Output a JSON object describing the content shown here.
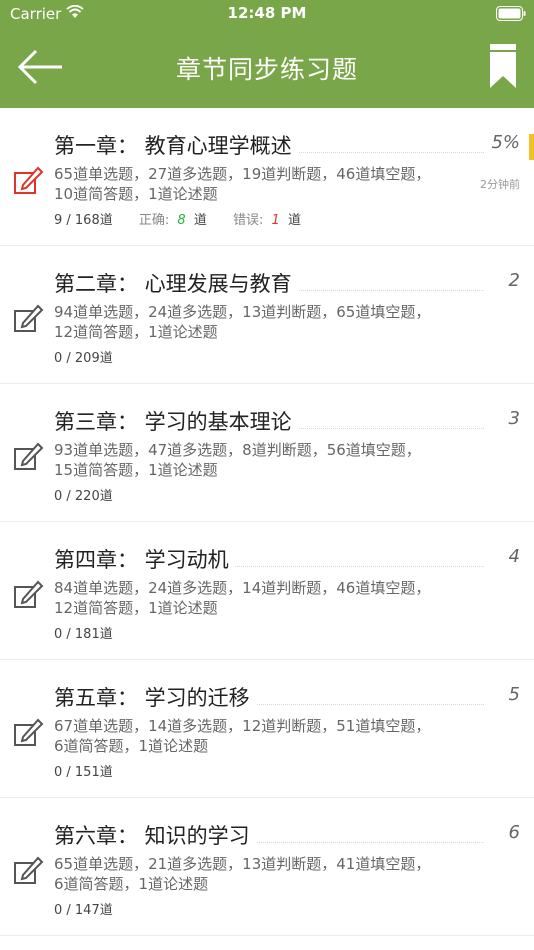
{
  "status_bar": {
    "carrier": "Carrier",
    "time": "12:48 PM"
  },
  "nav": {
    "title": "章节同步练习题"
  },
  "colors": {
    "header": "#7aa64a",
    "active_edit": "#e0342b",
    "correct": "#2cae3b",
    "wrong": "#e0342b",
    "accent": "#f3c02c"
  },
  "chapters": [
    {
      "title": "第一章： 教育心理学概述",
      "num": "5%",
      "desc": "65道单选题，27道多选题，19道判断题，46道填空题，10道简答题，1道论述题",
      "progress": "9 / 168道",
      "correct_label": "正确:",
      "correct": "8",
      "wrong_label": "错误:",
      "wrong": "1",
      "unit": "道",
      "ago": "2分钟前"
    },
    {
      "title": "第二章： 心理发展与教育",
      "num": "2",
      "desc": "94道单选题，24道多选题，13道判断题，65道填空题，12道简答题，1道论述题",
      "progress": "0 / 209道"
    },
    {
      "title": "第三章： 学习的基本理论",
      "num": "3",
      "desc": "93道单选题，47道多选题，8道判断题，56道填空题，15道简答题，1道论述题",
      "progress": "0 / 220道"
    },
    {
      "title": "第四章： 学习动机",
      "num": "4",
      "desc": "84道单选题，24道多选题，14道判断题，46道填空题，12道简答题，1道论述题",
      "progress": "0 / 181道"
    },
    {
      "title": "第五章： 学习的迁移",
      "num": "5",
      "desc": "67道单选题，14道多选题，12道判断题，51道填空题，6道简答题，1道论述题",
      "progress": "0 / 151道"
    },
    {
      "title": "第六章： 知识的学习",
      "num": "6",
      "desc": "65道单选题，21道多选题，13道判断题，41道填空题，6道简答题，1道论述题",
      "progress": "0 / 147道"
    }
  ]
}
